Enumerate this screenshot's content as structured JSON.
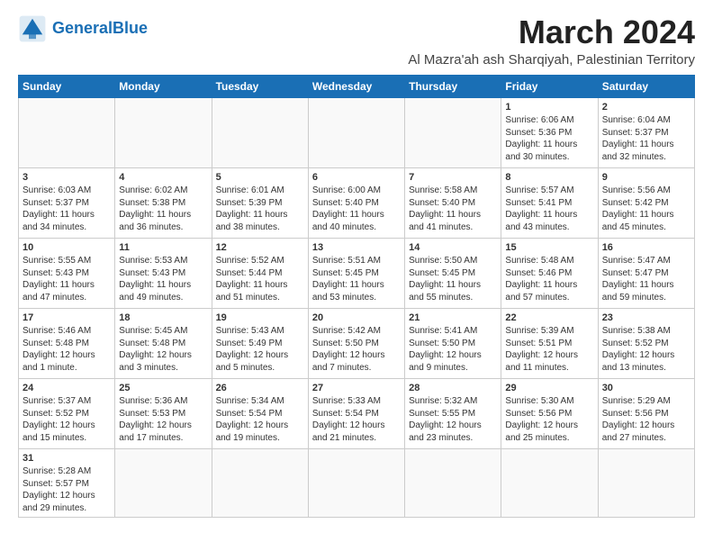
{
  "logo": {
    "text_general": "General",
    "text_blue": "Blue"
  },
  "title": "March 2024",
  "subtitle": "Al Mazra'ah ash Sharqiyah, Palestinian Territory",
  "header": {
    "days": [
      "Sunday",
      "Monday",
      "Tuesday",
      "Wednesday",
      "Thursday",
      "Friday",
      "Saturday"
    ]
  },
  "weeks": [
    {
      "cells": [
        {
          "day": "",
          "info": ""
        },
        {
          "day": "",
          "info": ""
        },
        {
          "day": "",
          "info": ""
        },
        {
          "day": "",
          "info": ""
        },
        {
          "day": "",
          "info": ""
        },
        {
          "day": "1",
          "info": "Sunrise: 6:06 AM\nSunset: 5:36 PM\nDaylight: 11 hours\nand 30 minutes."
        },
        {
          "day": "2",
          "info": "Sunrise: 6:04 AM\nSunset: 5:37 PM\nDaylight: 11 hours\nand 32 minutes."
        }
      ]
    },
    {
      "cells": [
        {
          "day": "3",
          "info": "Sunrise: 6:03 AM\nSunset: 5:37 PM\nDaylight: 11 hours\nand 34 minutes."
        },
        {
          "day": "4",
          "info": "Sunrise: 6:02 AM\nSunset: 5:38 PM\nDaylight: 11 hours\nand 36 minutes."
        },
        {
          "day": "5",
          "info": "Sunrise: 6:01 AM\nSunset: 5:39 PM\nDaylight: 11 hours\nand 38 minutes."
        },
        {
          "day": "6",
          "info": "Sunrise: 6:00 AM\nSunset: 5:40 PM\nDaylight: 11 hours\nand 40 minutes."
        },
        {
          "day": "7",
          "info": "Sunrise: 5:58 AM\nSunset: 5:40 PM\nDaylight: 11 hours\nand 41 minutes."
        },
        {
          "day": "8",
          "info": "Sunrise: 5:57 AM\nSunset: 5:41 PM\nDaylight: 11 hours\nand 43 minutes."
        },
        {
          "day": "9",
          "info": "Sunrise: 5:56 AM\nSunset: 5:42 PM\nDaylight: 11 hours\nand 45 minutes."
        }
      ]
    },
    {
      "cells": [
        {
          "day": "10",
          "info": "Sunrise: 5:55 AM\nSunset: 5:43 PM\nDaylight: 11 hours\nand 47 minutes."
        },
        {
          "day": "11",
          "info": "Sunrise: 5:53 AM\nSunset: 5:43 PM\nDaylight: 11 hours\nand 49 minutes."
        },
        {
          "day": "12",
          "info": "Sunrise: 5:52 AM\nSunset: 5:44 PM\nDaylight: 11 hours\nand 51 minutes."
        },
        {
          "day": "13",
          "info": "Sunrise: 5:51 AM\nSunset: 5:45 PM\nDaylight: 11 hours\nand 53 minutes."
        },
        {
          "day": "14",
          "info": "Sunrise: 5:50 AM\nSunset: 5:45 PM\nDaylight: 11 hours\nand 55 minutes."
        },
        {
          "day": "15",
          "info": "Sunrise: 5:48 AM\nSunset: 5:46 PM\nDaylight: 11 hours\nand 57 minutes."
        },
        {
          "day": "16",
          "info": "Sunrise: 5:47 AM\nSunset: 5:47 PM\nDaylight: 11 hours\nand 59 minutes."
        }
      ]
    },
    {
      "cells": [
        {
          "day": "17",
          "info": "Sunrise: 5:46 AM\nSunset: 5:48 PM\nDaylight: 12 hours\nand 1 minute."
        },
        {
          "day": "18",
          "info": "Sunrise: 5:45 AM\nSunset: 5:48 PM\nDaylight: 12 hours\nand 3 minutes."
        },
        {
          "day": "19",
          "info": "Sunrise: 5:43 AM\nSunset: 5:49 PM\nDaylight: 12 hours\nand 5 minutes."
        },
        {
          "day": "20",
          "info": "Sunrise: 5:42 AM\nSunset: 5:50 PM\nDaylight: 12 hours\nand 7 minutes."
        },
        {
          "day": "21",
          "info": "Sunrise: 5:41 AM\nSunset: 5:50 PM\nDaylight: 12 hours\nand 9 minutes."
        },
        {
          "day": "22",
          "info": "Sunrise: 5:39 AM\nSunset: 5:51 PM\nDaylight: 12 hours\nand 11 minutes."
        },
        {
          "day": "23",
          "info": "Sunrise: 5:38 AM\nSunset: 5:52 PM\nDaylight: 12 hours\nand 13 minutes."
        }
      ]
    },
    {
      "cells": [
        {
          "day": "24",
          "info": "Sunrise: 5:37 AM\nSunset: 5:52 PM\nDaylight: 12 hours\nand 15 minutes."
        },
        {
          "day": "25",
          "info": "Sunrise: 5:36 AM\nSunset: 5:53 PM\nDaylight: 12 hours\nand 17 minutes."
        },
        {
          "day": "26",
          "info": "Sunrise: 5:34 AM\nSunset: 5:54 PM\nDaylight: 12 hours\nand 19 minutes."
        },
        {
          "day": "27",
          "info": "Sunrise: 5:33 AM\nSunset: 5:54 PM\nDaylight: 12 hours\nand 21 minutes."
        },
        {
          "day": "28",
          "info": "Sunrise: 5:32 AM\nSunset: 5:55 PM\nDaylight: 12 hours\nand 23 minutes."
        },
        {
          "day": "29",
          "info": "Sunrise: 5:30 AM\nSunset: 5:56 PM\nDaylight: 12 hours\nand 25 minutes."
        },
        {
          "day": "30",
          "info": "Sunrise: 5:29 AM\nSunset: 5:56 PM\nDaylight: 12 hours\nand 27 minutes."
        }
      ]
    },
    {
      "cells": [
        {
          "day": "31",
          "info": "Sunrise: 5:28 AM\nSunset: 5:57 PM\nDaylight: 12 hours\nand 29 minutes."
        },
        {
          "day": "",
          "info": ""
        },
        {
          "day": "",
          "info": ""
        },
        {
          "day": "",
          "info": ""
        },
        {
          "day": "",
          "info": ""
        },
        {
          "day": "",
          "info": ""
        },
        {
          "day": "",
          "info": ""
        }
      ]
    }
  ]
}
